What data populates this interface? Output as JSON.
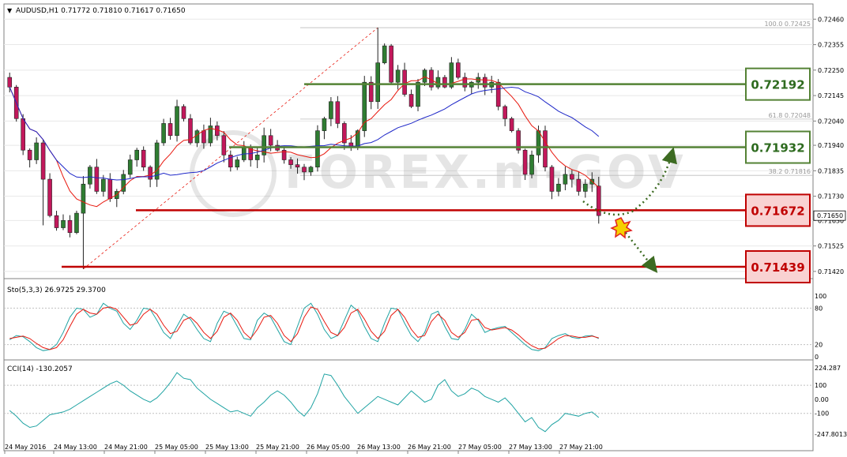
{
  "chart_data": [
    {
      "type": "candlestick",
      "header": "AUDUSD,H1  0.71772 0.71810 0.71617 0.71650",
      "ylim": [
        0.714,
        0.725
      ],
      "y_ticks": [
        "0.72460",
        "0.72355",
        "0.72250",
        "0.72145",
        "0.72040",
        "0.71940",
        "0.71835",
        "0.71730",
        "0.71630",
        "0.71525",
        "0.71420"
      ],
      "current_price": "0.71650",
      "current_price_value": 0.7165,
      "fib_labels": [
        {
          "text": "100.0 0.72425",
          "value": 0.72425
        },
        {
          "text": "61.8 0.72048",
          "value": 0.72048
        },
        {
          "text": "38.2 0.71816",
          "value": 0.71816
        }
      ],
      "levels": [
        {
          "label": "0.72192",
          "value": 0.72192,
          "color": "#548235",
          "kind": "resistance"
        },
        {
          "label": "0.71932",
          "value": 0.71932,
          "color": "#548235",
          "kind": "resistance"
        },
        {
          "label": "0.71672",
          "value": 0.71672,
          "color": "#c00000",
          "kind": "support"
        },
        {
          "label": "0.71439",
          "value": 0.71439,
          "color": "#c00000",
          "kind": "support"
        }
      ],
      "closes": [
        0.7218,
        0.7205,
        0.7192,
        0.7188,
        0.7195,
        0.718,
        0.7165,
        0.716,
        0.7163,
        0.7158,
        0.7166,
        0.7178,
        0.7185,
        0.7175,
        0.718,
        0.7172,
        0.7175,
        0.7182,
        0.7188,
        0.7192,
        0.7185,
        0.718,
        0.7195,
        0.7203,
        0.7198,
        0.721,
        0.7205,
        0.7195,
        0.72,
        0.7195,
        0.7202,
        0.7198,
        0.719,
        0.7185,
        0.7188,
        0.7193,
        0.7188,
        0.719,
        0.7198,
        0.7194,
        0.7192,
        0.7188,
        0.7186,
        0.7185,
        0.7183,
        0.7185,
        0.72,
        0.7205,
        0.7212,
        0.7203,
        0.7195,
        0.7193,
        0.72,
        0.722,
        0.7212,
        0.7228,
        0.7235,
        0.722,
        0.7225,
        0.7215,
        0.721,
        0.722,
        0.7225,
        0.7218,
        0.7222,
        0.7218,
        0.7228,
        0.7222,
        0.7218,
        0.722,
        0.7222,
        0.7218,
        0.722,
        0.721,
        0.7205,
        0.72,
        0.7192,
        0.7182,
        0.719,
        0.72,
        0.7185,
        0.7175,
        0.7178,
        0.7182,
        0.718,
        0.7175,
        0.7178,
        0.718,
        0.7165
      ],
      "candle_range": [
        0.71617,
        0.72425
      ],
      "overlays": [
        {
          "name": "MA red",
          "color": "#e8190f"
        },
        {
          "name": "MA blue",
          "color": "#1f28c8"
        }
      ],
      "x_ticks": [
        "24 May 2016",
        "24 May 13:00",
        "24 May 21:00",
        "25 May 05:00",
        "25 May 13:00",
        "25 May 21:00",
        "26 May 05:00",
        "26 May 13:00",
        "26 May 21:00",
        "27 May 05:00",
        "27 May 13:00",
        "27 May 21:00"
      ],
      "watermark": "FOREX.m-GOV"
    },
    {
      "type": "line",
      "header": "Sto(5,3,3) 26.9725 29.3700",
      "ylim": [
        0,
        100
      ],
      "y_ticks": [
        "100",
        "80",
        "20",
        "0"
      ],
      "series": [
        {
          "color": "#1fa3a3",
          "values": [
            28,
            35,
            33,
            25,
            15,
            10,
            12,
            20,
            40,
            65,
            80,
            78,
            65,
            70,
            88,
            80,
            75,
            55,
            45,
            60,
            80,
            78,
            60,
            40,
            30,
            50,
            70,
            62,
            45,
            30,
            25,
            55,
            75,
            70,
            50,
            30,
            28,
            60,
            72,
            65,
            45,
            25,
            20,
            50,
            80,
            88,
            70,
            45,
            30,
            35,
            60,
            85,
            75,
            50,
            30,
            25,
            55,
            80,
            78,
            55,
            35,
            25,
            40,
            70,
            75,
            50,
            30,
            28,
            45,
            70,
            60,
            40,
            45,
            48,
            50,
            40,
            30,
            20,
            12,
            10,
            15,
            30,
            35,
            38,
            32,
            30,
            34,
            35,
            30
          ]
        },
        {
          "color": "#e8190f",
          "values": [
            30,
            32,
            34,
            30,
            22,
            15,
            12,
            15,
            28,
            50,
            70,
            78,
            72,
            70,
            80,
            82,
            78,
            65,
            52,
            55,
            70,
            78,
            70,
            52,
            38,
            42,
            60,
            65,
            55,
            40,
            30,
            42,
            65,
            72,
            60,
            40,
            30,
            45,
            65,
            68,
            55,
            35,
            25,
            38,
            65,
            82,
            78,
            58,
            40,
            35,
            48,
            72,
            78,
            62,
            42,
            30,
            42,
            68,
            78,
            65,
            45,
            32,
            35,
            58,
            70,
            60,
            40,
            32,
            40,
            60,
            62,
            48,
            44,
            46,
            48,
            44,
            36,
            26,
            18,
            13,
            14,
            22,
            30,
            35,
            34,
            32,
            32,
            34,
            31
          ]
        }
      ]
    },
    {
      "type": "line",
      "header": "CCI(14) -130.2057",
      "ylim": [
        -247.8013,
        224.287
      ],
      "y_ticks": [
        "224.287",
        "100",
        "0.00",
        "-100",
        "-247.8013"
      ],
      "series": [
        {
          "color": "#1fa3a3",
          "values": [
            -80,
            -120,
            -170,
            -200,
            -190,
            -150,
            -110,
            -100,
            -90,
            -70,
            -40,
            -10,
            20,
            50,
            80,
            110,
            130,
            100,
            60,
            30,
            0,
            -20,
            10,
            60,
            120,
            190,
            150,
            140,
            80,
            40,
            0,
            -30,
            -60,
            -90,
            -80,
            -100,
            -120,
            -60,
            -20,
            30,
            60,
            30,
            -20,
            -80,
            -120,
            -60,
            40,
            180,
            170,
            100,
            20,
            -40,
            -100,
            -60,
            -20,
            20,
            0,
            -20,
            -40,
            10,
            60,
            20,
            -20,
            0,
            100,
            140,
            60,
            20,
            40,
            80,
            60,
            20,
            0,
            -20,
            10,
            -40,
            -100,
            -160,
            -130,
            -200,
            -230,
            -180,
            -150,
            -100,
            -110,
            -120,
            -100,
            -90,
            -130
          ]
        }
      ]
    }
  ]
}
